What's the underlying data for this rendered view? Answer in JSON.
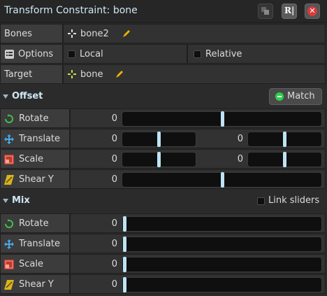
{
  "window": {
    "title": "Transform Constraint: bone",
    "buttons": [
      "copy-icon",
      "rename-icon",
      "close-icon"
    ]
  },
  "bones": {
    "label": "Bones",
    "value": "bone2",
    "icon": "bone-icon",
    "edit_icon": "pencil-icon"
  },
  "options": {
    "label": "Options",
    "local": "Local",
    "relative": "Relative",
    "local_checked": false,
    "relative_checked": false
  },
  "target": {
    "label": "Target",
    "value": "bone",
    "icon": "bone-icon",
    "edit_icon": "pencil-icon"
  },
  "offset": {
    "title": "Offset",
    "match_label": "Match",
    "rows": [
      {
        "label": "Rotate",
        "icon": "rotate-icon",
        "value": "0",
        "slider": 0.5
      },
      {
        "label": "Translate",
        "icon": "translate-icon",
        "x": "0",
        "y": "0",
        "slider_x": 0.5,
        "slider_y": 0.5
      },
      {
        "label": "Scale",
        "icon": "scale-icon",
        "x": "0",
        "y": "0",
        "slider_x": 0.5,
        "slider_y": 0.5
      },
      {
        "label": "Shear Y",
        "icon": "shear-icon",
        "value": "0",
        "slider": 0.5
      }
    ]
  },
  "mix": {
    "title": "Mix",
    "link_label": "Link sliders",
    "link_checked": false,
    "rows": [
      {
        "label": "Rotate",
        "icon": "rotate-icon",
        "value": "0",
        "slider": 0
      },
      {
        "label": "Translate",
        "icon": "translate-icon",
        "value": "0",
        "slider": 0
      },
      {
        "label": "Scale",
        "icon": "scale-icon",
        "value": "0",
        "slider": 0
      },
      {
        "label": "Shear Y",
        "icon": "shear-icon",
        "value": "0",
        "slider": 0
      }
    ]
  },
  "colors": {
    "accent": "#cfe7f5",
    "slider_knob": "#bfe3f3",
    "match_green": "#2fcf4d",
    "close_red": "#d83a3a"
  }
}
